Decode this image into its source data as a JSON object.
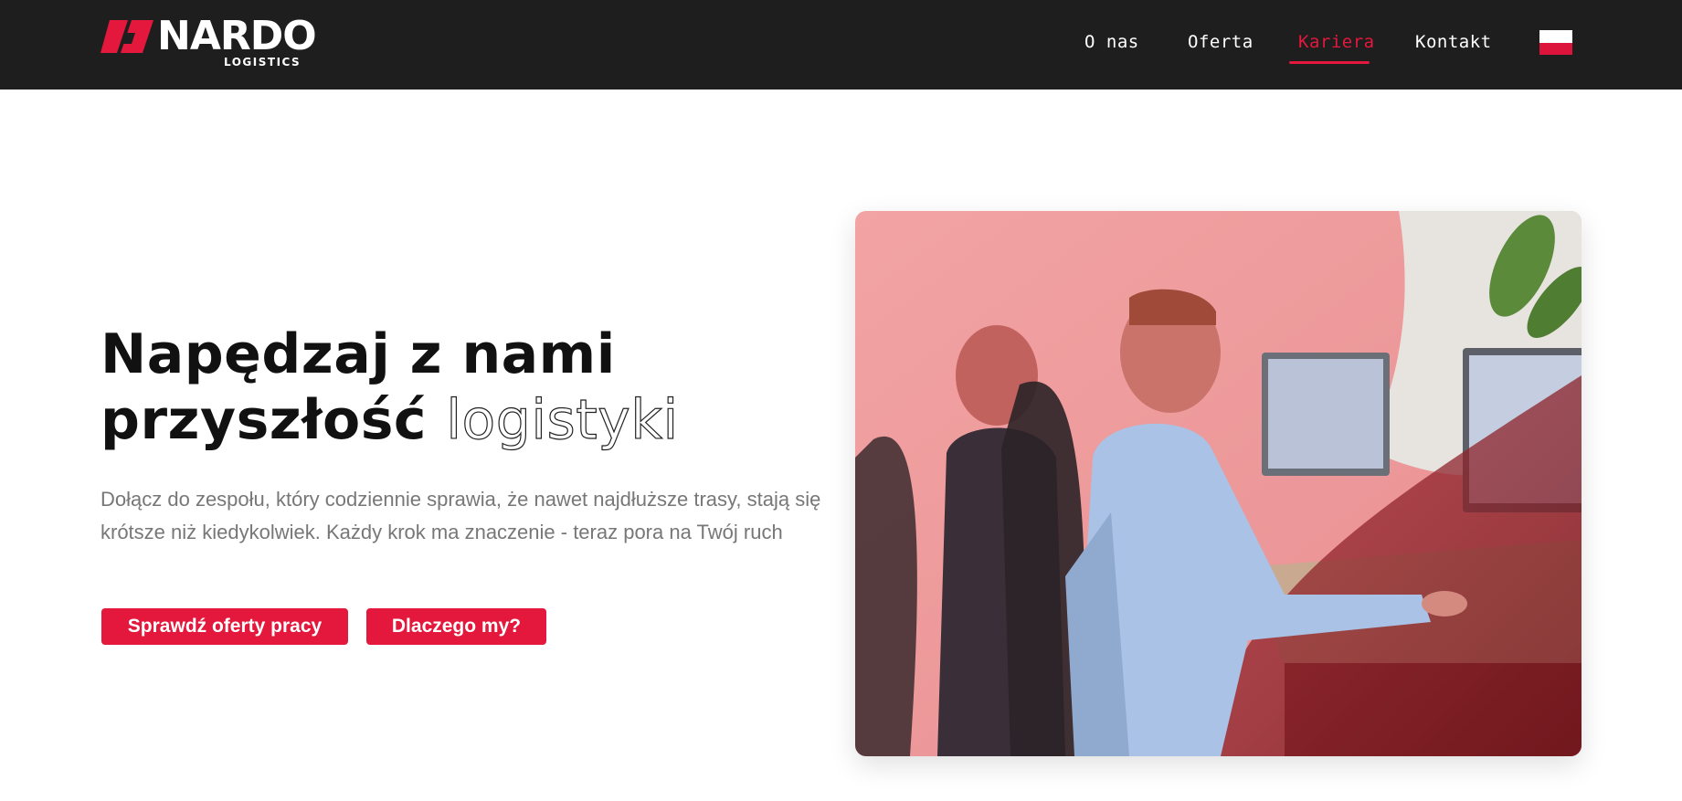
{
  "brand": {
    "name": "NARDO",
    "subtitle": "LOGISTICS",
    "colors": {
      "accent": "#e3183c",
      "navbar": "#1e1e1e"
    }
  },
  "nav": {
    "items": [
      {
        "label": "O nas"
      },
      {
        "label": "Oferta"
      },
      {
        "label": "Kariera",
        "active": true
      },
      {
        "label": "Kontakt"
      }
    ],
    "language_flag": "poland-flag-icon"
  },
  "hero": {
    "headline_line1": "Napędzaj z nami",
    "headline_line2_bold": "przyszłość",
    "headline_line2_outline": "logistyki",
    "lead": "Dołącz do zespołu, który codziennie sprawia, że nawet najdłuższe trasy, stają się krótsze niż kiedykolwiek. Każdy krok ma znaczenie - teraz pora na Twój ruch",
    "buttons": {
      "primary": "Sprawdź oferty pracy",
      "secondary": "Dlaczego my?"
    },
    "photo": "office-workers-photo"
  }
}
